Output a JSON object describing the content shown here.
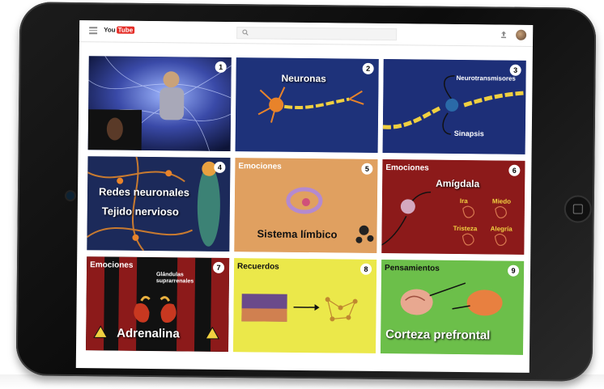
{
  "header": {
    "logo_you": "You",
    "logo_tube": "Tube",
    "icons": [
      "menu-icon",
      "search-icon",
      "upload-icon",
      "avatar"
    ]
  },
  "videos": [
    {
      "number": "1"
    },
    {
      "number": "2",
      "title": "Neuronas"
    },
    {
      "number": "3",
      "top_label": "Neurotransmisores",
      "bottom_label": "Sinapsis"
    },
    {
      "number": "4",
      "line1": "Redes neuronales",
      "line2": "Tejido nervioso"
    },
    {
      "number": "5",
      "category": "Emociones",
      "title": "Sistema límbico"
    },
    {
      "number": "6",
      "category": "Emociones",
      "title": "Amígdala",
      "emotions": [
        "Ira",
        "Miedo",
        "Tristeza",
        "Alegría"
      ]
    },
    {
      "number": "7",
      "category": "Emociones",
      "label": "Glándulas suprarrenales",
      "title": "Adrenalina"
    },
    {
      "number": "8",
      "category": "Recuerdos"
    },
    {
      "number": "9",
      "category": "Pensamientos",
      "title": "Corteza prefrontal"
    }
  ],
  "colors": {
    "tablet": "#111111",
    "card2_bg": "#233a8a",
    "card5_bg": "#e0a060",
    "card6_bg": "#8c1a1a",
    "card8_bg": "#ebe84a",
    "card9_bg": "#6cbf4a",
    "chain": "#f0d040"
  }
}
